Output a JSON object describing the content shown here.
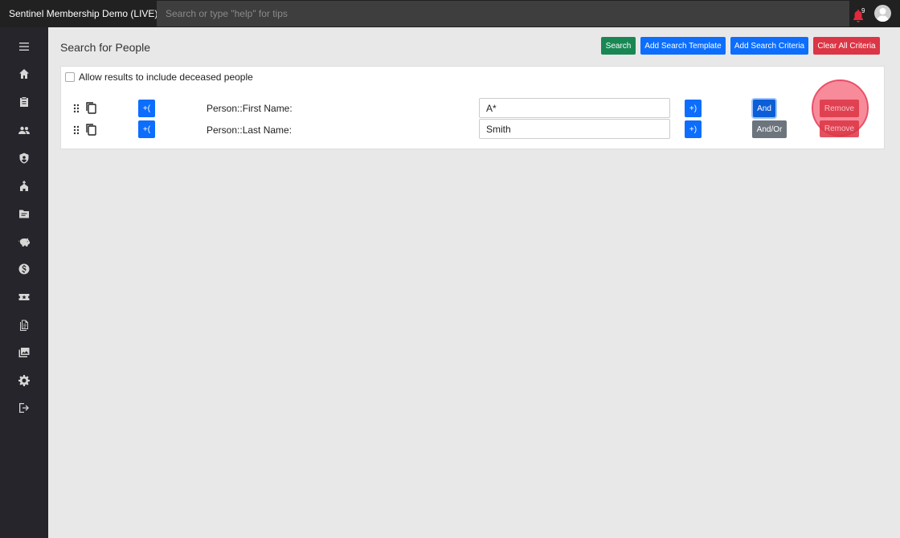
{
  "header": {
    "app_title": "Sentinel Membership Demo (LIVE)",
    "search_placeholder": "Search or type \"help\" for tips",
    "notification_count": "9"
  },
  "sidebar": {
    "items": [
      {
        "icon": "menu-icon"
      },
      {
        "icon": "home-icon"
      },
      {
        "icon": "clipboard-icon"
      },
      {
        "icon": "people-icon"
      },
      {
        "icon": "shield-icon"
      },
      {
        "icon": "church-icon"
      },
      {
        "icon": "folder-icon"
      },
      {
        "icon": "piggy-bank-icon"
      },
      {
        "icon": "dollar-icon"
      },
      {
        "icon": "ticket-icon"
      },
      {
        "icon": "document-icon"
      },
      {
        "icon": "photos-icon"
      },
      {
        "icon": "gear-icon"
      },
      {
        "icon": "logout-icon"
      }
    ]
  },
  "page": {
    "title": "Search for People",
    "buttons": {
      "search": "Search",
      "add_template": "Add Search Template",
      "add_criteria": "Add Search Criteria",
      "clear_all": "Clear All Criteria"
    },
    "deceased_label": "Allow results to include deceased people",
    "deceased_checked": false,
    "criteria": [
      {
        "open_paren": "+(",
        "label": "Person::First Name:",
        "value": "A*",
        "close_paren": "+)",
        "logic": "And",
        "remove": "Remove"
      },
      {
        "open_paren": "+(",
        "label": "Person::Last Name:",
        "value": "Smith",
        "close_paren": "+)",
        "logic": "And/Or",
        "remove": "Remove"
      }
    ]
  },
  "colors": {
    "accent_blue": "#0d6efd",
    "success_green": "#198754",
    "danger_red": "#dc3545",
    "topbar": "#212121",
    "sidebar": "#25252b"
  }
}
